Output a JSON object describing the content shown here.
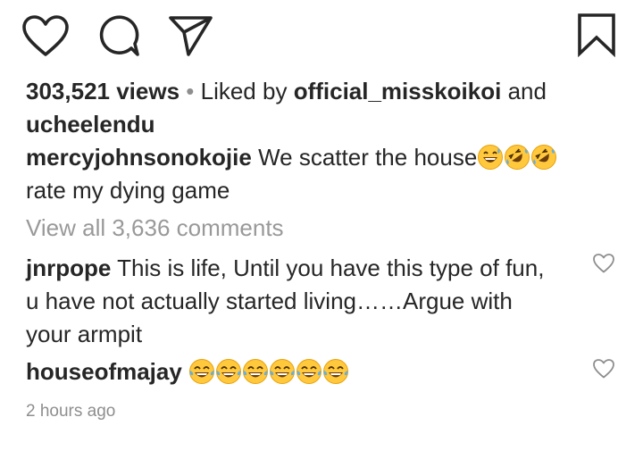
{
  "actions": {
    "like_icon": "heart-outline-icon",
    "comment_icon": "comment-bubble-icon",
    "share_icon": "paper-plane-icon",
    "save_icon": "bookmark-icon"
  },
  "stats": {
    "views": "303,521 views",
    "separator": " • ",
    "liked_by_prefix": "Liked by ",
    "liked_user_1": "official_misskoikoi",
    "and": " and",
    "liked_user_2": "ucheelendu"
  },
  "caption": {
    "username": "mercyjohnsonokojie",
    "text_1": " We scatter the house",
    "emojis": [
      "grinning-sweat",
      "rofl",
      "rofl"
    ],
    "text_2": "rate my dying game"
  },
  "view_all": "View all 3,636 comments",
  "comments": [
    {
      "username": "jnrpope",
      "text": " This is life, Until you have this type of fun, u have not actually started living……Argue with your armpit"
    },
    {
      "username": "houseofmajay",
      "text": " ",
      "emojis": [
        "tears-of-joy",
        "tears-of-joy",
        "tears-of-joy",
        "tears-of-joy",
        "tears-of-joy",
        "tears-of-joy"
      ]
    }
  ],
  "timestamp": "2 hours ago",
  "colors": {
    "text": "#262626",
    "muted": "#8e8e8e",
    "emoji_yellow": "#FFC83D"
  }
}
